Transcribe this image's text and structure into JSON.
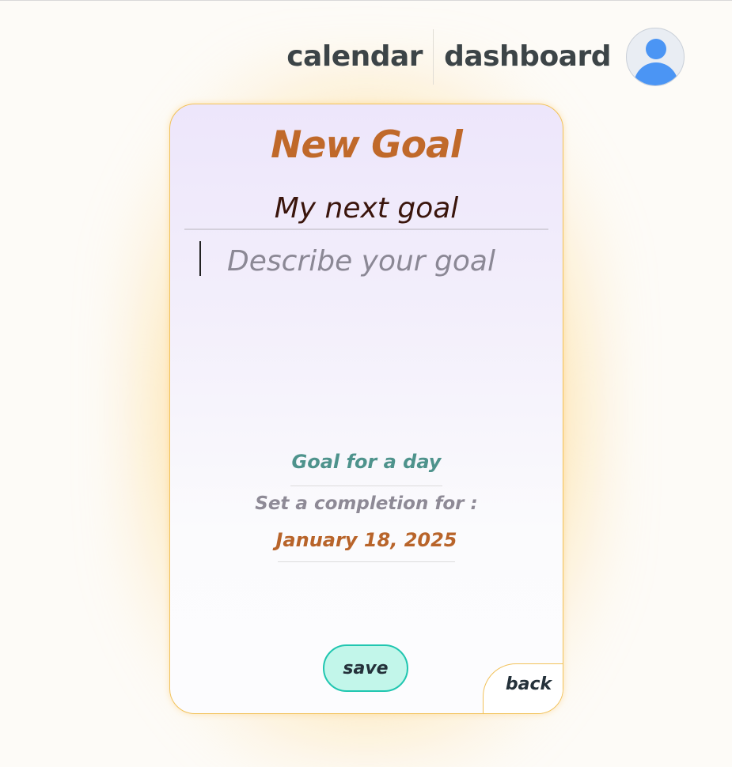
{
  "nav": {
    "calendar_label": "calendar",
    "dashboard_label": "dashboard",
    "avatar_icon": "user-avatar-icon"
  },
  "form": {
    "title": "New Goal",
    "goal_title_value": "My next goal",
    "description_placeholder": "Describe your goal",
    "description_value": "",
    "goal_type_label": "Goal for a day",
    "completion_label": "Set a completion for :",
    "completion_date": "January 18, 2025",
    "save_label": "save",
    "back_label": "back"
  },
  "colors": {
    "title": "#c0692a",
    "goal_type": "#4e938c",
    "date": "#b8642a",
    "save_bg": "#c2f6ea",
    "save_border": "#20c6b0",
    "card_border": "#f2c25a",
    "avatar": "#4b95f4"
  }
}
